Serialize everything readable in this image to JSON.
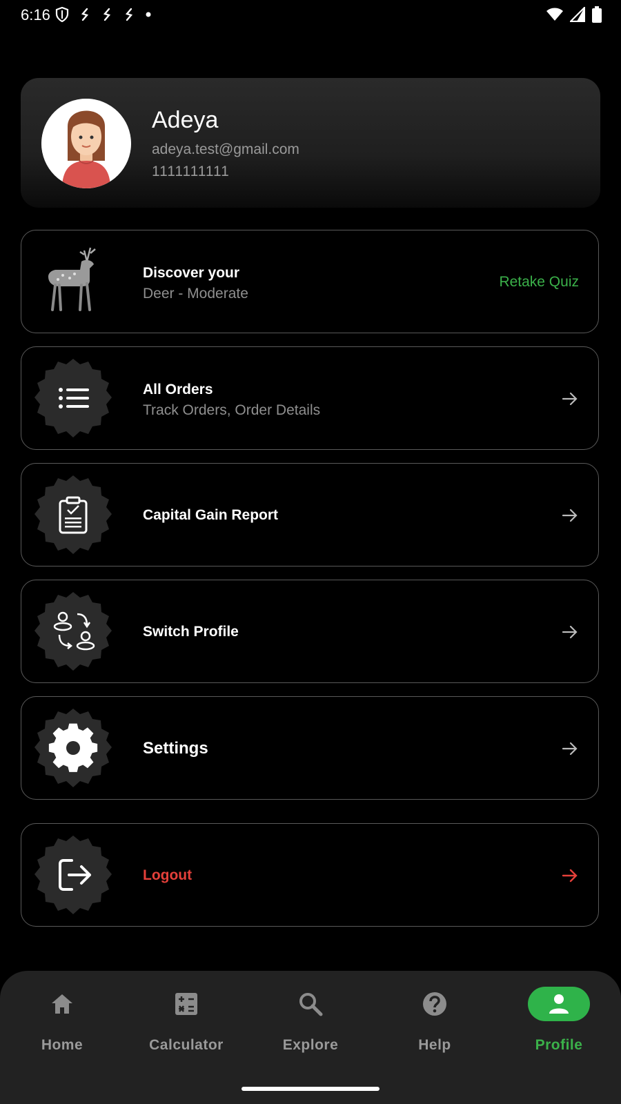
{
  "status_bar": {
    "time": "6:16"
  },
  "profile": {
    "name": "Adeya",
    "email": "adeya.test@gmail.com",
    "phone": "1111111111"
  },
  "menu": {
    "quiz": {
      "title": "Discover your",
      "subtitle": "Deer - Moderate",
      "action": "Retake Quiz"
    },
    "orders": {
      "title": "All Orders",
      "subtitle": "Track Orders, Order Details"
    },
    "capital_gain": {
      "title": "Capital Gain Report"
    },
    "switch_profile": {
      "title": "Switch Profile"
    },
    "settings": {
      "title": "Settings"
    },
    "logout": {
      "title": "Logout"
    }
  },
  "bottom_nav": {
    "items": [
      {
        "label": "Home",
        "icon": "home-icon"
      },
      {
        "label": "Calculator",
        "icon": "calculator-icon"
      },
      {
        "label": "Explore",
        "icon": "search-icon"
      },
      {
        "label": "Help",
        "icon": "help-icon"
      },
      {
        "label": "Profile",
        "icon": "person-icon",
        "active": true
      }
    ]
  },
  "colors": {
    "accent_green": "#3bb14a",
    "logout_red": "#e5403a",
    "card_border": "#5a5a5a",
    "background": "#000000"
  }
}
